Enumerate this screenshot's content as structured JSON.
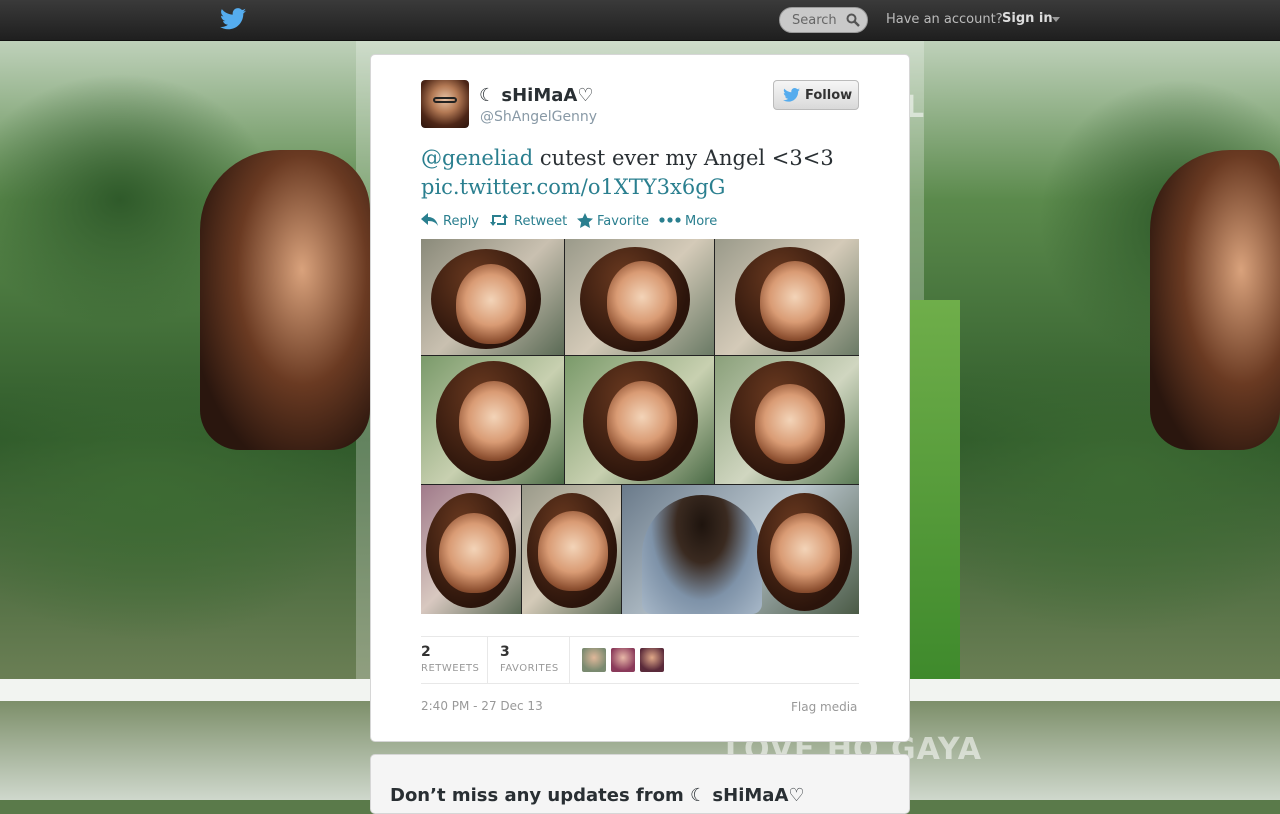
{
  "topbar": {
    "logo": "twitter-bird-icon",
    "search_placeholder": "Search",
    "have_account": "Have an account?",
    "sign_in": "Sign in"
  },
  "background": {
    "watermark_top": "L\nLOVE HO GAYA",
    "watermark_top_text": "L",
    "watermark_bottom": "LOVE HO GAYA"
  },
  "tweet": {
    "fullname": "☾ sHiMaA♡",
    "username": "@ShAngelGenny",
    "follow_label": "Follow",
    "text_mention": "@geneliad",
    "text_body": " cutest ever my Angel <3<3",
    "text_link": "pic.twitter.com/o1XTY3x6gG",
    "actions": {
      "reply": "Reply",
      "retweet": "Retweet",
      "favorite": "Favorite",
      "more": "More"
    },
    "stats": {
      "retweets_count": "2",
      "retweets_label": "RETWEETS",
      "favorites_count": "3",
      "favorites_label": "FAVORITES"
    },
    "timestamp": "2:40 PM - 27 Dec 13",
    "flag_media": "Flag media"
  },
  "bottom_card": {
    "message": "Don’t miss any updates from ☾ sHiMaA♡"
  },
  "colors": {
    "link": "#2a7f8f",
    "topbar": "#2b2b2b",
    "twitter_blue": "#55acee"
  }
}
